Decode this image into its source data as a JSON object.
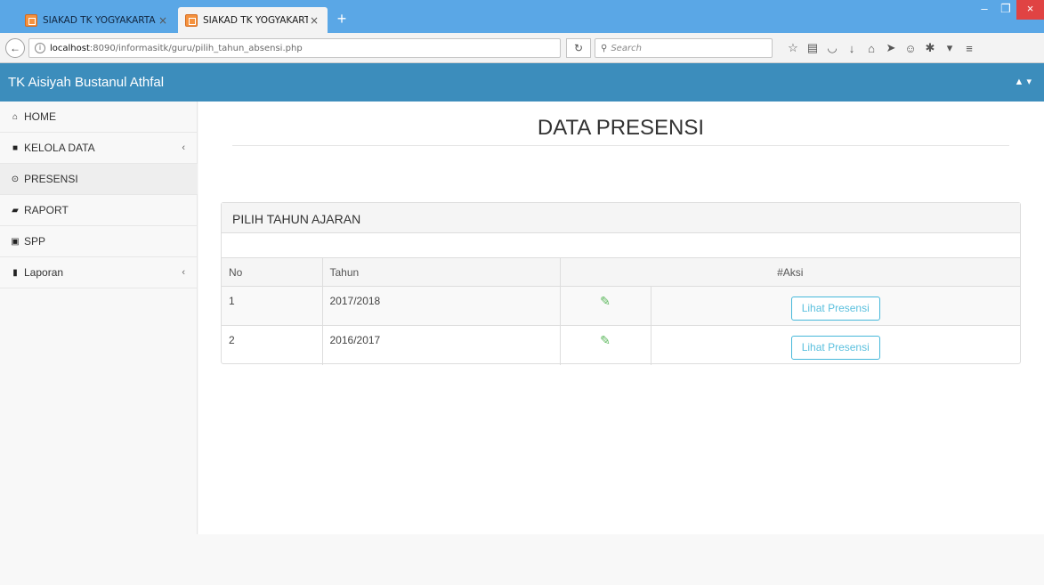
{
  "browser": {
    "tabs": [
      {
        "title": "SIAKAD TK YOGYAKARTA",
        "close": "×"
      },
      {
        "title": "SIAKAD TK YOGYAKARTA",
        "close": "×"
      }
    ],
    "new_tab": "+",
    "window_controls": {
      "minimize": "–",
      "maximize": "❐",
      "close": "×"
    },
    "url_host": "localhost",
    "url_rest": ":8090/informasitk/guru/pilih_tahun_absensi.php",
    "search_placeholder": "Search",
    "reload": "↻",
    "back": "←",
    "toolbar_icons": [
      "star-icon",
      "reading-list-icon",
      "pocket-icon",
      "download-icon",
      "home-icon",
      "send-icon",
      "emoji-icon",
      "extension-icon",
      "menu-icon"
    ]
  },
  "app": {
    "brand": "TK Aisiyah Bustanul Athfal",
    "user_menu": "▲ ▾",
    "accent_color": "#3c8dbc"
  },
  "sidebar": {
    "items": [
      {
        "label": "HOME",
        "icon": "home-icon",
        "glyph": "⌂"
      },
      {
        "label": "KELOLA DATA",
        "icon": "folder-icon",
        "glyph": "■",
        "caret": "‹"
      },
      {
        "label": "PRESENSI",
        "icon": "clock-icon",
        "glyph": "⊙"
      },
      {
        "label": "RAPORT",
        "icon": "book-icon",
        "glyph": "▰"
      },
      {
        "label": "SPP",
        "icon": "money-icon",
        "glyph": "▣"
      },
      {
        "label": "Laporan",
        "icon": "file-icon",
        "glyph": "▮",
        "caret": "‹"
      }
    ]
  },
  "main": {
    "page_title": "DATA PRESENSI",
    "panel_heading": "PILIH TAHUN AJARAN",
    "table": {
      "headers": [
        "No",
        "Tahun",
        "#Aksi"
      ],
      "rows": [
        {
          "no": "1",
          "tahun": "2017/2018",
          "button": "Lihat Presensi"
        },
        {
          "no": "2",
          "tahun": "2016/2017",
          "button": "Lihat Presensi"
        }
      ]
    }
  }
}
